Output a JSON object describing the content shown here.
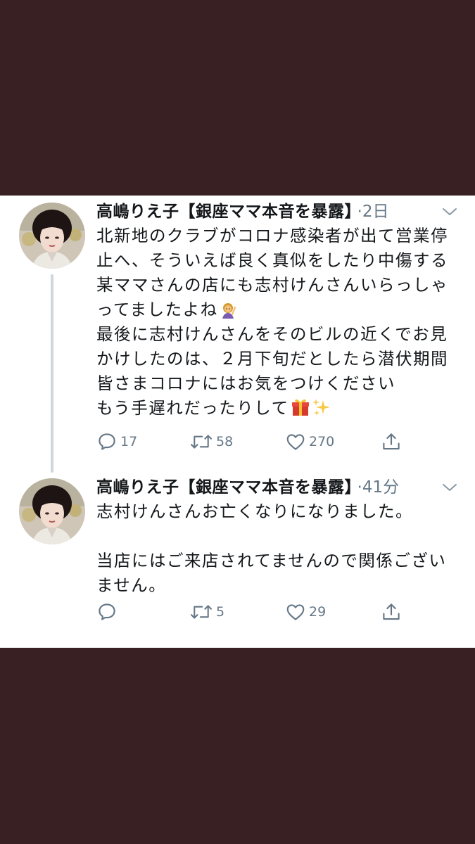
{
  "tweets": [
    {
      "author": "高嶋りえ子【銀座ママ本音を暴露】",
      "time": "2日",
      "lines": [
        "北新地のクラブがコロナ感染者が出て営業停",
        "止へ、そういえば良く真似をしたり中傷する",
        "某ママさんの店にも志村けんさんいらっしゃ",
        "ってましたよね",
        "最後に志村けんさんをそのビルの近くでお見",
        "かけしたのは、２月下旬だとしたら潜伏期間",
        "皆さまコロナにはお気をつけください",
        "もう手遅れだったりして"
      ],
      "emojis": [
        "woman-raising-hand-emoji",
        "gift-emoji",
        "sparkles-emoji"
      ],
      "reply_count": "17",
      "retweet_count": "58",
      "like_count": "270"
    },
    {
      "author": "高嶋りえ子【銀座ママ本音を暴露】",
      "time": "41分",
      "lines": [
        "志村けんさんお亡くなりになりました。",
        "",
        "当店にはご来店されてませんので関係ござい",
        "ません。"
      ],
      "reply_count": "",
      "retweet_count": "5",
      "like_count": "29"
    }
  ],
  "separator": "·",
  "icons": {
    "reply": "reply-icon",
    "retweet": "retweet-icon",
    "like": "like-icon",
    "share": "share-icon",
    "caret": "chevron-down-icon"
  },
  "colors": {
    "outer_background": "#382023",
    "card_background": "#ffffff",
    "text": "#14171a",
    "muted": "#657786",
    "thread_line": "#cfd6dc"
  }
}
